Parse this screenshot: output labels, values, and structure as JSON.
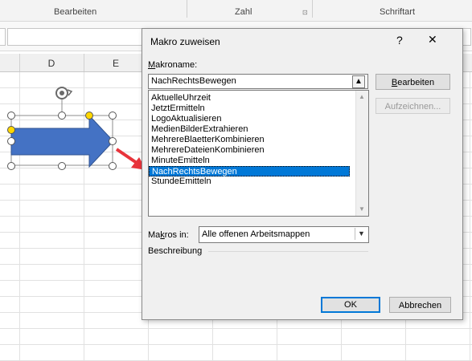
{
  "ribbon": {
    "groups": [
      "Bearbeiten",
      "Zahl",
      "Schriftart"
    ],
    "launcher": "⊡"
  },
  "columns": [
    "D",
    "E"
  ],
  "icons": {
    "rotate": "rotate-handle-icon",
    "help": "help-icon",
    "close": "close-icon",
    "upload": "up-arrow-icon",
    "dropdown": "chevron-down-icon"
  },
  "dialog": {
    "title": "Makro zuweisen",
    "help": "?",
    "close": "✕",
    "macro_name_label_pre": "",
    "macro_name_label_u": "M",
    "macro_name_label_post": "akroname:",
    "macro_name_value": "NachRechtsBewegen",
    "macro_list": [
      "AktuelleUhrzeit",
      "JetztErmitteln",
      "LogoAktualisieren",
      "MedienBilderExtrahieren",
      "MehrereBlaetterKombinieren",
      "MehrereDateienKombinieren",
      "MinuteEmitteln",
      "NachRechtsBewegen",
      "StundeEmitteln"
    ],
    "selected_index": 7,
    "edit_button_u": "B",
    "edit_button_rest": "earbeiten",
    "record_button": "Aufzeichnen...",
    "macros_in_label_pre": "Ma",
    "macros_in_label_u": "k",
    "macros_in_label_post": "ros in:",
    "macros_in_value": "Alle offenen Arbeitsmappen",
    "description_label": "Beschreibung",
    "ok_button": "OK",
    "cancel_button": "Abbrechen"
  },
  "colors": {
    "selection": "#0078d7",
    "shape_fill": "#4472c4",
    "pointer_arrow": "#e8343b"
  }
}
